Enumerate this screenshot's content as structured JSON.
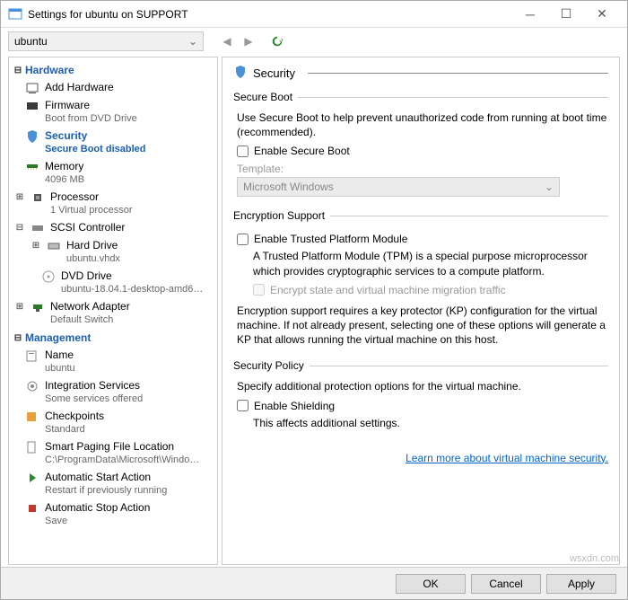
{
  "window": {
    "title": "Settings for ubuntu on SUPPORT"
  },
  "toolbar": {
    "vm_name": "ubuntu"
  },
  "sidebar": {
    "hardware_title": "Hardware",
    "management_title": "Management",
    "items": {
      "add_hardware": "Add Hardware",
      "firmware": "Firmware",
      "firmware_sub": "Boot from DVD Drive",
      "security": "Security",
      "security_sub": "Secure Boot disabled",
      "memory": "Memory",
      "memory_sub": "4096 MB",
      "processor": "Processor",
      "processor_sub": "1 Virtual processor",
      "scsi": "SCSI Controller",
      "hard_drive": "Hard Drive",
      "hard_drive_sub": "ubuntu.vhdx",
      "dvd_drive": "DVD Drive",
      "dvd_drive_sub": "ubuntu-18.04.1-desktop-amd6…",
      "network": "Network Adapter",
      "network_sub": "Default Switch",
      "name": "Name",
      "name_sub": "ubuntu",
      "integration": "Integration Services",
      "integration_sub": "Some services offered",
      "checkpoints": "Checkpoints",
      "checkpoints_sub": "Standard",
      "smart_paging": "Smart Paging File Location",
      "smart_paging_sub": "C:\\ProgramData\\Microsoft\\Windo…",
      "auto_start": "Automatic Start Action",
      "auto_start_sub": "Restart if previously running",
      "auto_stop": "Automatic Stop Action",
      "auto_stop_sub": "Save"
    }
  },
  "main": {
    "title": "Security",
    "secure_boot": {
      "legend": "Secure Boot",
      "desc": "Use Secure Boot to help prevent unauthorized code from running at boot time (recommended).",
      "enable": "Enable Secure Boot",
      "template_label": "Template:",
      "template_value": "Microsoft Windows"
    },
    "encryption": {
      "legend": "Encryption Support",
      "enable_tpm": "Enable Trusted Platform Module",
      "tpm_desc": "A Trusted Platform Module (TPM) is a special purpose microprocessor which provides cryptographic services to a compute platform.",
      "encrypt_state": "Encrypt state and virtual machine migration traffic",
      "note": "Encryption support requires a key protector (KP) configuration for the virtual machine. If not already present, selecting one of these options will generate a KP that allows running the virtual machine on this host."
    },
    "policy": {
      "legend": "Security Policy",
      "desc": "Specify additional protection options for the virtual machine.",
      "enable_shielding": "Enable Shielding",
      "shielding_note": "This affects additional settings."
    },
    "link": "Learn more about virtual machine security."
  },
  "footer": {
    "ok": "OK",
    "cancel": "Cancel",
    "apply": "Apply"
  },
  "watermark": "wsxdn.com"
}
